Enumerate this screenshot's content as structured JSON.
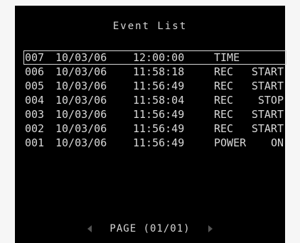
{
  "screen": {
    "title": "Event List"
  },
  "events": [
    {
      "num": "007",
      "date": "10/03/06",
      "time": "12:00:00",
      "event": "TIME",
      "event_extra": ""
    },
    {
      "num": "006",
      "date": "10/03/06",
      "time": "11:58:18",
      "event": "REC",
      "event_extra": "START"
    },
    {
      "num": "005",
      "date": "10/03/06",
      "time": "11:56:49",
      "event": "REC",
      "event_extra": "START"
    },
    {
      "num": "004",
      "date": "10/03/06",
      "time": "11:58:04",
      "event": "REC",
      "event_extra": "STOP"
    },
    {
      "num": "003",
      "date": "10/03/06",
      "time": "11:56:49",
      "event": "REC",
      "event_extra": "START"
    },
    {
      "num": "002",
      "date": "10/03/06",
      "time": "11:56:49",
      "event": "REC",
      "event_extra": "START"
    },
    {
      "num": "001",
      "date": "10/03/06",
      "time": "11:56:49",
      "event": "POWER",
      "event_extra": "ON"
    }
  ],
  "pager": {
    "label": "PAGE",
    "value": "(01/01)",
    "prev_icon": "triangle-left-icon",
    "next_icon": "triangle-right-icon"
  },
  "colors": {
    "background": "#000000",
    "text": "#d8d8d8",
    "arrow": "#555555"
  }
}
